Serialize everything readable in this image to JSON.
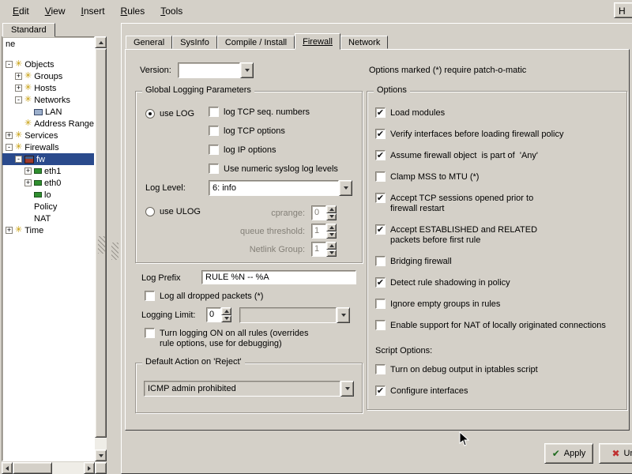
{
  "colors": {
    "window_bg": "#d4d0c8",
    "selection": "#2a4a8c",
    "apply_check": "#1f6b1f",
    "undo_red": "#c03030"
  },
  "menubar": {
    "items": [
      "Edit",
      "View",
      "Insert",
      "Rules",
      "Tools"
    ],
    "overflow_item": "H"
  },
  "sidebar": {
    "tab": "Standard",
    "header": "ne",
    "tree": [
      {
        "label": "Objects",
        "level": 0,
        "expander": "minus",
        "icon": "library",
        "selected": false
      },
      {
        "label": "Groups",
        "level": 1,
        "expander": "plus",
        "icon": "library",
        "selected": false
      },
      {
        "label": "Hosts",
        "level": 1,
        "expander": "plus",
        "icon": "library",
        "selected": false
      },
      {
        "label": "Networks",
        "level": 1,
        "expander": "minus",
        "icon": "library",
        "selected": false
      },
      {
        "label": "LAN",
        "level": 2,
        "expander": "none",
        "icon": "network",
        "selected": false
      },
      {
        "label": "Address Range",
        "level": 1,
        "expander": "none",
        "icon": "library",
        "selected": false
      },
      {
        "label": "Services",
        "level": 0,
        "expander": "plus",
        "icon": "library",
        "selected": false
      },
      {
        "label": "Firewalls",
        "level": 0,
        "expander": "minus",
        "icon": "library",
        "selected": false
      },
      {
        "label": "fw",
        "level": 1,
        "expander": "minus",
        "icon": "firewall",
        "selected": true
      },
      {
        "label": "eth1",
        "level": 2,
        "expander": "plus",
        "icon": "interface",
        "selected": false
      },
      {
        "label": "eth0",
        "level": 2,
        "expander": "plus",
        "icon": "interface",
        "selected": false
      },
      {
        "label": "lo",
        "level": 2,
        "expander": "none",
        "icon": "interface",
        "selected": false
      },
      {
        "label": "Policy",
        "level": 2,
        "expander": "none",
        "icon": "none",
        "selected": false
      },
      {
        "label": "NAT",
        "level": 2,
        "expander": "none",
        "icon": "none",
        "selected": false
      },
      {
        "label": "Time",
        "level": 0,
        "expander": "plus",
        "icon": "library",
        "selected": false
      }
    ]
  },
  "dialog": {
    "tabs": [
      "General",
      "SysInfo",
      "Compile / Install",
      "Firewall",
      "Network"
    ],
    "active_tab": "Firewall",
    "version_label": "Version:",
    "version_value": "",
    "patch_note": "Options marked (*) require patch-o-matic",
    "logging_group": {
      "title": "Global Logging Parameters",
      "use_log": {
        "label": "use LOG",
        "selected": true
      },
      "log_checkboxes": [
        {
          "label": "log TCP seq. numbers",
          "checked": false
        },
        {
          "label": "log TCP options",
          "checked": false
        },
        {
          "label": "log IP options",
          "checked": false
        },
        {
          "label": "Use numeric syslog log levels",
          "checked": false
        }
      ],
      "log_level": {
        "label": "Log Level:",
        "value": "6: info"
      },
      "use_ulog": {
        "label": "use ULOG",
        "selected": false
      },
      "ulog_params": [
        {
          "label": "cprange:",
          "value": "0"
        },
        {
          "label": "queue threshold:",
          "value": "1"
        },
        {
          "label": "Netlink Group:",
          "value": "1"
        }
      ]
    },
    "log_prefix": {
      "label": "Log Prefix",
      "value": "RULE %N -- %A"
    },
    "log_all_dropped": {
      "label": "Log all dropped packets (*)",
      "checked": false
    },
    "logging_limit": {
      "label": "Logging Limit:",
      "value": "0",
      "combo_value": ""
    },
    "turn_logging_on": {
      "label": "Turn logging ON on all rules (overrides\nrule options, use for debugging)",
      "checked": false
    },
    "default_action": {
      "title": "Default Action on 'Reject'",
      "value": "ICMP admin prohibited"
    },
    "options": {
      "title": "Options",
      "items": [
        {
          "label": "Load modules",
          "checked": true
        },
        {
          "label": "Verify interfaces before loading firewall policy",
          "checked": true
        },
        {
          "label": "Assume firewall object  is part of  'Any'",
          "checked": true
        },
        {
          "label": "Clamp MSS to MTU (*)",
          "checked": false
        },
        {
          "label": "Accept TCP sessions opened prior to\nfirewall restart",
          "checked": true
        },
        {
          "label": "Accept ESTABLISHED and RELATED\npackets before first rule",
          "checked": true
        },
        {
          "label": "Bridging firewall",
          "checked": false
        },
        {
          "label": "Detect rule shadowing in policy",
          "checked": true
        },
        {
          "label": "Ignore empty groups in rules",
          "checked": false
        },
        {
          "label": "Enable support for NAT of locally originated connections",
          "checked": false
        }
      ],
      "script_title": "Script Options:",
      "script_items": [
        {
          "label": "Turn on debug output in iptables script",
          "checked": false
        },
        {
          "label": "Configure interfaces",
          "checked": true
        }
      ]
    }
  },
  "footer": {
    "apply_label": "Apply",
    "undo_label": "Un",
    "apply_icon": "check-icon",
    "undo_icon": "undo-icon"
  }
}
